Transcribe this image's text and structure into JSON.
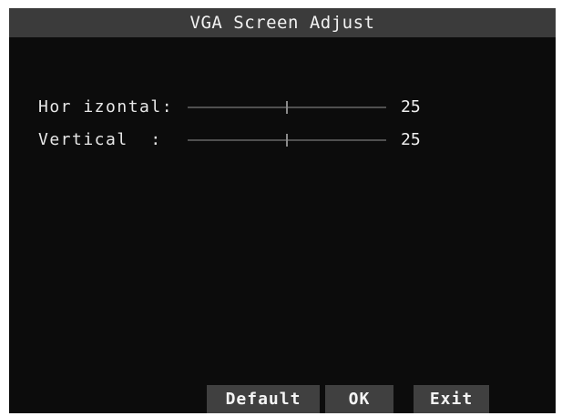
{
  "dialog": {
    "title": "VGA Screen Adjust"
  },
  "settings": [
    {
      "label": "Hor izontal:",
      "value": "25",
      "slider_fraction": 0.5
    },
    {
      "label": "Vertical  :",
      "value": "25",
      "slider_fraction": 0.5
    }
  ],
  "buttons": {
    "default_label": "Default",
    "ok_label": "OK",
    "exit_label": "Exit"
  },
  "colors": {
    "background": "#0c0c0c",
    "title_bar": "#3b3b3b",
    "button": "#404040",
    "text": "#f0f0f0"
  }
}
